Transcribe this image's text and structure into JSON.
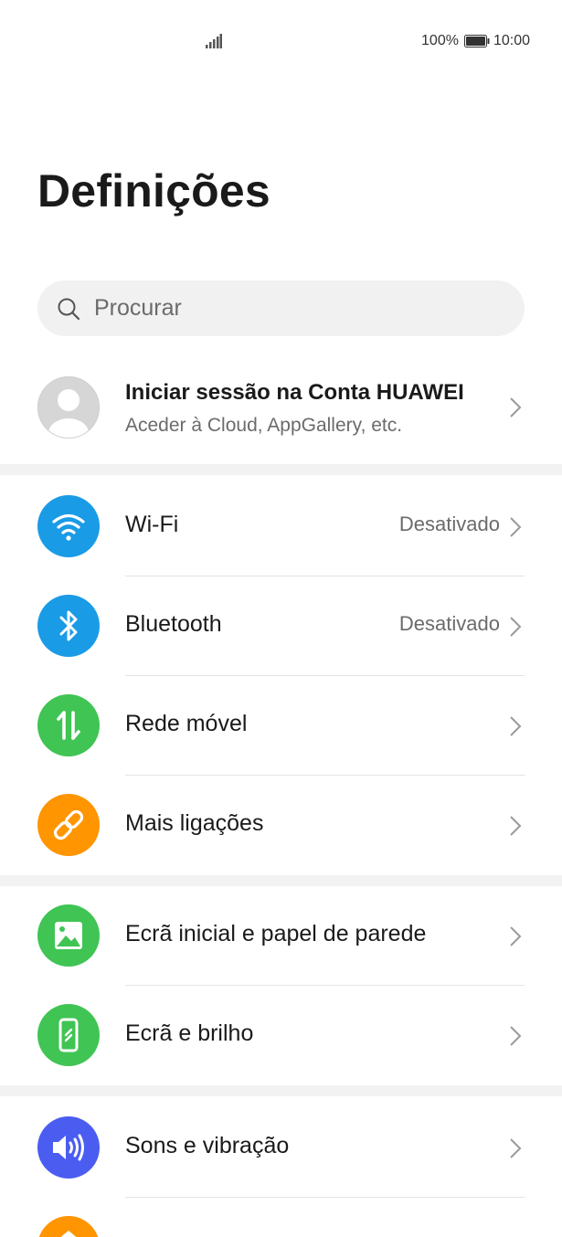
{
  "status_bar": {
    "battery_percent": "100%",
    "time": "10:00"
  },
  "page": {
    "title": "Definições"
  },
  "search": {
    "placeholder": "Procurar"
  },
  "account": {
    "title": "Iniciar sessão na Conta HUAWEI",
    "subtitle": "Aceder à Cloud, AppGallery, etc."
  },
  "colors": {
    "wifi": "#1a9be6",
    "bluetooth": "#1a9be6",
    "mobile": "#40c454",
    "more": "#ff9500",
    "home": "#40c454",
    "display": "#40c454",
    "sound": "#4b5df0"
  },
  "groups": {
    "connectivity": [
      {
        "label": "Wi-Fi",
        "value": "Desativado",
        "icon": "wifi-icon"
      },
      {
        "label": "Bluetooth",
        "value": "Desativado",
        "icon": "bluetooth-icon"
      },
      {
        "label": "Rede móvel",
        "value": "",
        "icon": "mobile-data-icon"
      },
      {
        "label": "Mais ligações",
        "value": "",
        "icon": "link-icon"
      }
    ],
    "display": [
      {
        "label": "Ecrã inicial e papel de parede",
        "icon": "wallpaper-icon"
      },
      {
        "label": "Ecrã e brilho",
        "icon": "phone-brightness-icon"
      }
    ],
    "sound": [
      {
        "label": "Sons e vibração",
        "icon": "speaker-icon"
      }
    ]
  }
}
